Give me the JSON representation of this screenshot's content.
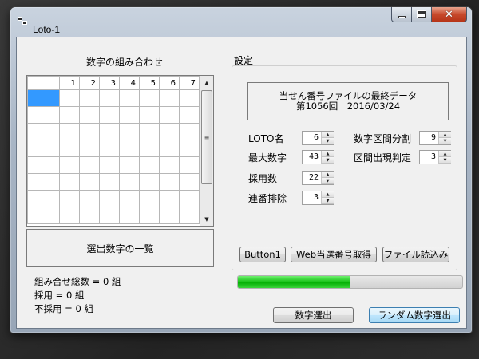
{
  "window": {
    "title": "Loto-1"
  },
  "grid": {
    "title": "数字の組み合わせ",
    "columns": [
      "",
      "1",
      "2",
      "3",
      "4",
      "5",
      "6",
      "7"
    ],
    "rows": 8
  },
  "selection_list": {
    "label": "選出数字の一覧"
  },
  "summary": {
    "total": "組み合せ総数 = 0 組",
    "adopted": "採用 = 0 組",
    "rejected": "不採用 = 0 組"
  },
  "settings": {
    "label": "設定",
    "last_data_line1": "当せん番号ファイルの最終データ",
    "last_data_line2": "第1056回　2016/03/24",
    "fields": {
      "loto_name": {
        "label": "LOTO名",
        "value": "6"
      },
      "max_number": {
        "label": "最大数字",
        "value": "43"
      },
      "adopt_count": {
        "label": "採用数",
        "value": "22"
      },
      "consecutive_exclude": {
        "label": "連番排除",
        "value": "3"
      },
      "range_divide": {
        "label": "数字区間分割",
        "value": "9"
      },
      "range_judge": {
        "label": "区間出現判定",
        "value": "3"
      }
    },
    "buttons": {
      "button1": "Button1",
      "web_fetch": "Web当選番号取得",
      "file_load": "ファイル読込み"
    }
  },
  "progress": {
    "value": 0.5,
    "color": "#1ec51e"
  },
  "actions": {
    "select_numbers": "数字選出",
    "random_select": "ランダム数字選出"
  }
}
